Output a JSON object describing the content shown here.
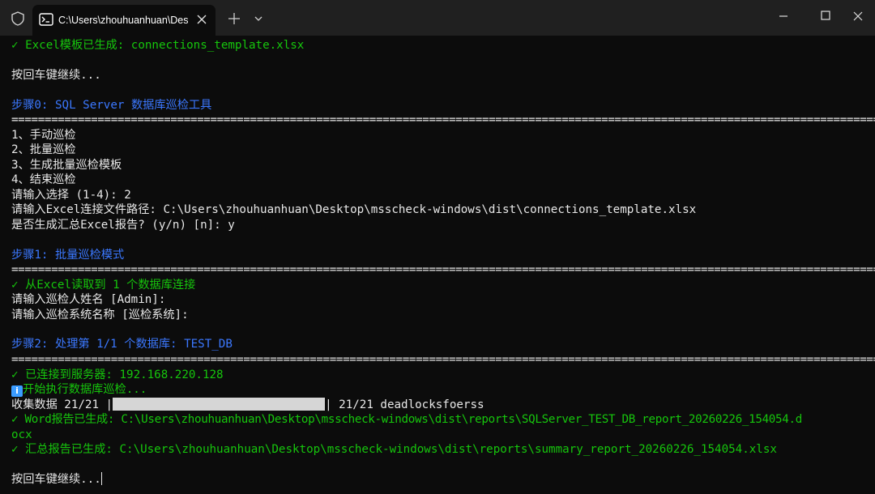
{
  "titlebar": {
    "tab_title": "C:\\Users\\zhouhuanhuan\\Desktop\\msscheck-windows\\dist",
    "icons": {
      "shield": "shield-icon",
      "tab": "terminal-icon",
      "close_tab": "close-icon",
      "new_tab": "plus-icon",
      "dropdown": "chevron-down-icon",
      "minimize": "minimize-icon",
      "maximize": "maximize-icon",
      "close_window": "close-icon"
    }
  },
  "terminal": {
    "lines": [
      "✓ Excel模板已生成: connections_template.xlsx",
      "",
      "按回车键继续...",
      "",
      "步骤0: SQL Server 数据库巡检工具",
      "======================================================================================================================================",
      "1、手动巡检",
      "2、批量巡检",
      "3、生成批量巡检模板",
      "4、结束巡检",
      "请输入选择 (1-4): 2",
      "请输入Excel连接文件路径: C:\\Users\\zhouhuanhuan\\Desktop\\msscheck-windows\\dist\\connections_template.xlsx",
      "是否生成汇总Excel报告? (y/n) [n]: y",
      "",
      "步骤1: 批量巡检模式",
      "======================================================================================================================================",
      "✓ 从Excel读取到 1 个数据库连接",
      "请输入巡检人姓名 [Admin]:",
      "请输入巡检系统名称 [巡检系统]:",
      "",
      "步骤2: 处理第 1/1 个数据库: TEST_DB",
      "======================================================================================================================================",
      "✓ 已连接到服务器: 192.168.220.128",
      "开始执行数据库巡检...",
      "收集数据 21/21 |",
      "| 21/21 deadlocksfoerss",
      "✓ Word报告已生成: C:\\Users\\zhouhuanhuan\\Desktop\\msscheck-windows\\dist\\reports\\SQLServer_TEST_DB_report_20260226_154054.d",
      "ocx",
      "✓ 汇总报告已生成: C:\\Users\\zhouhuanhuan\\Desktop\\msscheck-windows\\dist\\reports\\summary_report_20260226_154054.xlsx",
      "",
      "按回车键继续..."
    ],
    "progress": 1.0,
    "info_icon": "info-icon",
    "colors": {
      "background": "#0c0c0c",
      "text": "#cccccc",
      "green": "#16c60c",
      "blue": "#3b78ff",
      "titlebar": "#202020"
    }
  }
}
